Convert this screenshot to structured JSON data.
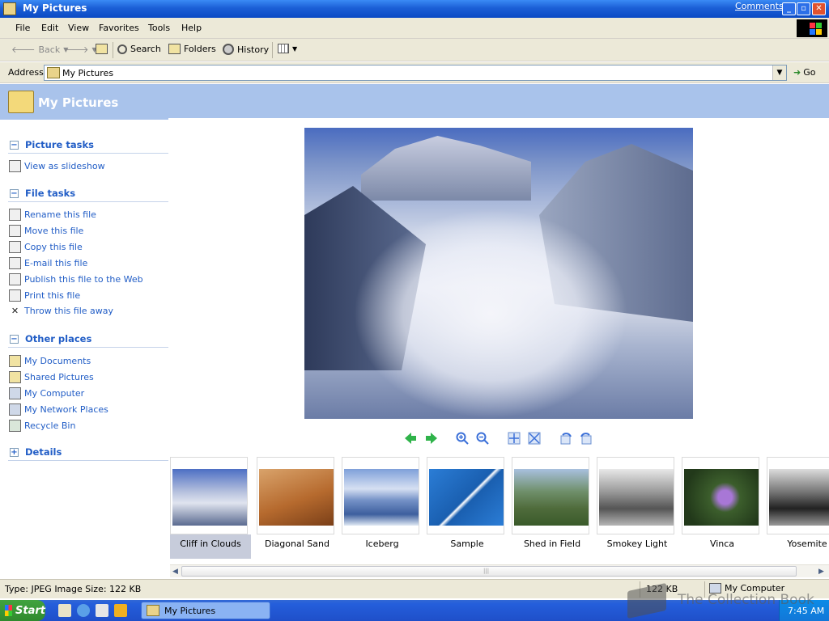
{
  "window": {
    "title": "My Pictures",
    "comments_link": "Comments?",
    "min_label": "_",
    "max_label": "▫",
    "close_label": "✕"
  },
  "menu": [
    "File",
    "Edit",
    "View",
    "Favorites",
    "Tools",
    "Help"
  ],
  "toolbar": {
    "back": "Back",
    "search": "Search",
    "folders": "Folders",
    "history": "History"
  },
  "address": {
    "label": "Address",
    "value": "My Pictures",
    "go": "Go"
  },
  "header": {
    "title": "My Pictures"
  },
  "sections": {
    "picture_tasks": {
      "title": "Picture tasks",
      "items": [
        "View as slideshow"
      ]
    },
    "file_tasks": {
      "title": "File tasks",
      "items": [
        "Rename this file",
        "Move this file",
        "Copy this file",
        "E-mail this file",
        "Publish this file to the Web",
        "Print this file",
        "Throw this file away"
      ]
    },
    "other_places": {
      "title": "Other places",
      "items": [
        "My Documents",
        "Shared Pictures",
        "My Computer",
        "My Network Places",
        "Recycle Bin"
      ]
    },
    "details": {
      "title": "Details"
    }
  },
  "thumbnails": [
    "Cliff in Clouds",
    "Diagonal Sand",
    "Iceberg",
    "Sample",
    "Shed in Field",
    "Smokey Light",
    "Vinca",
    "Yosemite"
  ],
  "status": {
    "type_size": "Type: JPEG Image Size: 122 KB",
    "size": "122 KB",
    "zone": "My Computer"
  },
  "taskbar": {
    "start": "Start",
    "task": "My Pictures",
    "clock": "7:45 AM"
  },
  "watermark": "The Collection Book"
}
